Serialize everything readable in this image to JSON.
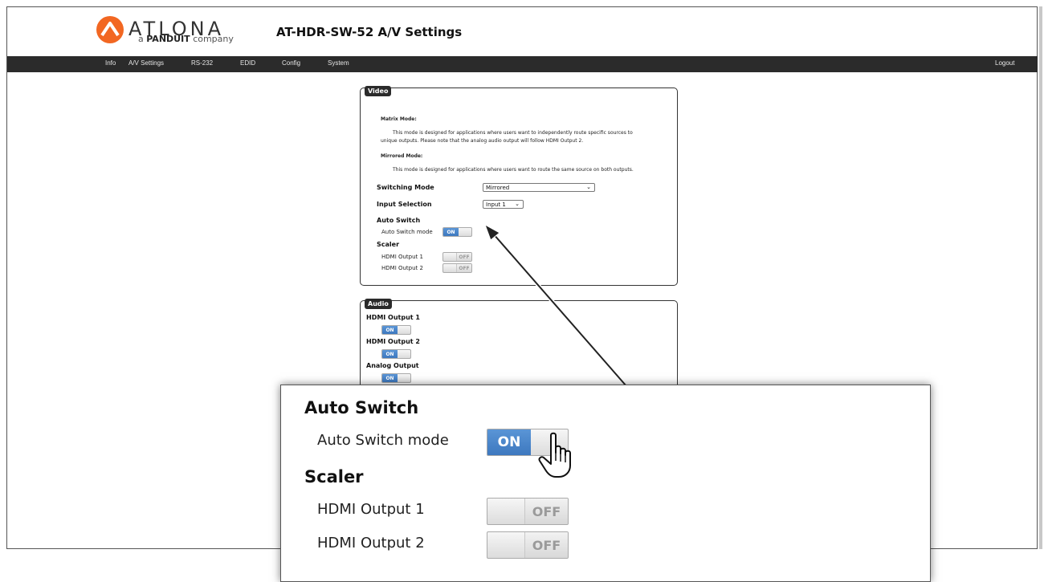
{
  "brand": {
    "name": "ATLONA",
    "sub_prefix": "a",
    "sub_brand": "PANDUIT",
    "sub_suffix": "company",
    "accent": "#f26722"
  },
  "page_title": "AT-HDR-SW-52  A/V Settings",
  "nav": {
    "items": [
      "Info",
      "A/V Settings",
      "RS-232",
      "EDID",
      "Config",
      "System"
    ],
    "logout": "Logout"
  },
  "video": {
    "tab": "Video",
    "matrix_heading": "Matrix Mode:",
    "matrix_text_1": "This mode is designed for applications where users want to independently route specific sources to",
    "matrix_text_2": "unique outputs. Please note that the analog audio output will follow HDMI Output 2.",
    "mirrored_heading": "Mirrored Mode:",
    "mirrored_text": "This mode is designed for applications where users want to route the same source on both outputs.",
    "switching_mode_label": "Switching Mode",
    "switching_mode_value": "Mirrored",
    "input_selection_label": "Input Selection",
    "input_selection_value": "Input 1",
    "auto_switch_heading": "Auto Switch",
    "auto_switch_label": "Auto Switch mode",
    "auto_switch_state": "ON",
    "scaler_heading": "Scaler",
    "scaler_out1_label": "HDMI Output 1",
    "scaler_out1_state": "OFF",
    "scaler_out2_label": "HDMI Output 2",
    "scaler_out2_state": "OFF"
  },
  "audio": {
    "tab": "Audio",
    "hdmi1_label": "HDMI Output 1",
    "hdmi1_state": "ON",
    "hdmi2_label": "HDMI Output 2",
    "hdmi2_state": "ON",
    "analog_label": "Analog Output",
    "analog_state": "ON"
  },
  "zoom": {
    "auto_switch_heading": "Auto Switch",
    "auto_switch_label": "Auto Switch mode",
    "auto_switch_state": "ON",
    "scaler_heading": "Scaler",
    "out1_label": "HDMI Output 1",
    "out1_state": "OFF",
    "out2_label": "HDMI Output 2",
    "out2_state": "OFF"
  },
  "colors": {
    "navbar": "#2b2b2b",
    "toggle_on": "#3d78bf",
    "toggle_off_text": "#9a9a9a"
  }
}
